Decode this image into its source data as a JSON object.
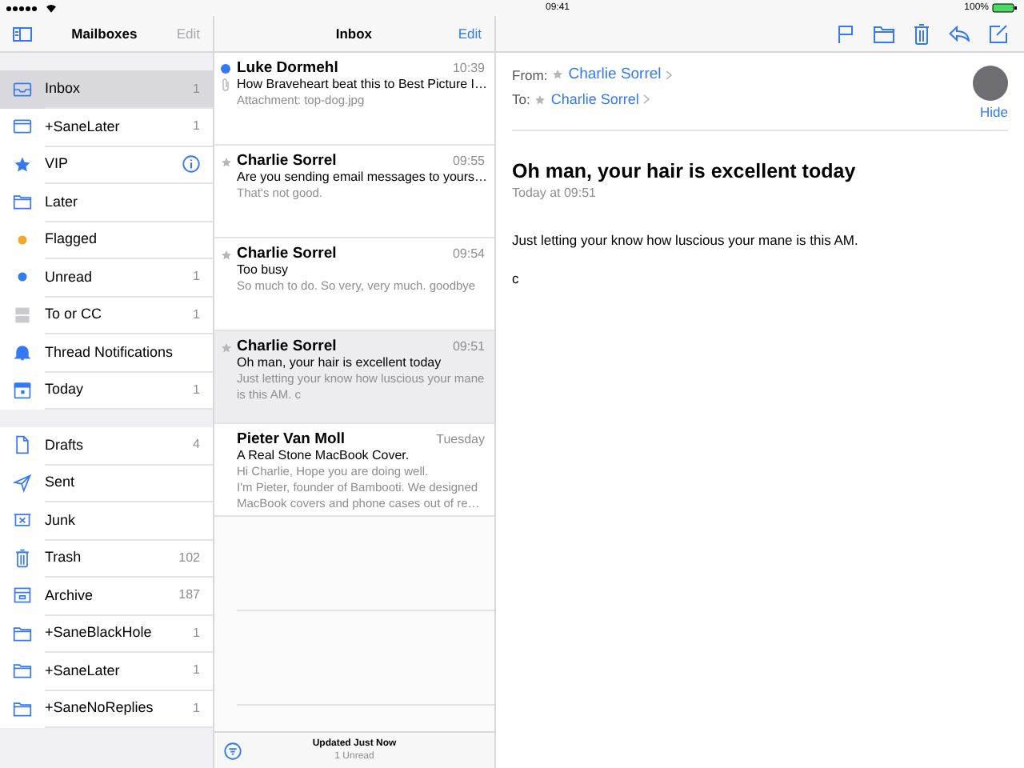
{
  "status_bar": {
    "time": "09:41",
    "battery": "100%"
  },
  "sidebar": {
    "title": "Mailboxes",
    "edit": {
      "label": "Edit",
      "disabled": true
    },
    "sections": [
      {
        "items": [
          {
            "kind": "inbox",
            "label": "Inbox",
            "count": "1",
            "selected": true
          },
          {
            "kind": "tray",
            "label": "+SaneLater",
            "count": "1",
            "selected": false
          },
          {
            "kind": "vip",
            "label": "VIP",
            "selected": false
          },
          {
            "kind": "folder",
            "label": "Later",
            "selected": false
          },
          {
            "kind": "dot",
            "label": "Flagged",
            "color": "#f5a623",
            "selected": false
          },
          {
            "kind": "dot",
            "label": "Unread",
            "count": "1",
            "color": "#2f7cf6",
            "selected": false
          },
          {
            "kind": "tocc",
            "label": "To or CC",
            "count": "1",
            "selected": false
          },
          {
            "kind": "bell",
            "label": "Thread Notifications",
            "selected": false
          },
          {
            "kind": "calendar",
            "label": "Today",
            "count": "1",
            "selected": false
          }
        ]
      },
      {
        "items": [
          {
            "kind": "drafts",
            "label": "Drafts",
            "count": "4",
            "selected": false
          },
          {
            "kind": "sent",
            "label": "Sent",
            "selected": false
          },
          {
            "kind": "junk",
            "label": "Junk",
            "selected": false
          },
          {
            "kind": "trash",
            "label": "Trash",
            "count": "102",
            "selected": false
          },
          {
            "kind": "archive",
            "label": "Archive",
            "count": "187",
            "selected": false
          },
          {
            "kind": "folder",
            "label": "+SaneBlackHole",
            "count": "1",
            "selected": false
          },
          {
            "kind": "folder",
            "label": "+SaneLater",
            "count": "1",
            "selected": false
          },
          {
            "kind": "folder",
            "label": "+SaneNoReplies",
            "count": "1",
            "selected": false
          }
        ]
      }
    ]
  },
  "inbox": {
    "title": "Inbox",
    "edit": {
      "label": "Edit",
      "disabled": false
    },
    "messages": [
      {
        "sender": "Luke Dormehl",
        "time": "10:39",
        "subject": "How Braveheart beat this to Best Picture I…",
        "preview": "Attachment: top-dog.jpg",
        "unread": true,
        "vip": false,
        "attachment": true,
        "selected": false
      },
      {
        "sender": "Charlie Sorrel",
        "time": "09:55",
        "subject": "Are you sending email messages to yours…",
        "preview": "That's not good.",
        "unread": false,
        "vip": true,
        "attachment": false,
        "selected": false
      },
      {
        "sender": "Charlie Sorrel",
        "time": "09:54",
        "subject": "Too busy",
        "preview": "So much to do. So very, very much. goodbye",
        "unread": false,
        "vip": true,
        "attachment": false,
        "selected": false
      },
      {
        "sender": "Charlie Sorrel",
        "time": "09:51",
        "subject": "Oh man, your hair is excellent today",
        "preview": "Just letting your know how luscious your mane is this AM. c",
        "unread": false,
        "vip": true,
        "attachment": false,
        "selected": true
      },
      {
        "sender": "Pieter Van Moll",
        "time": "Tuesday",
        "subject": "A Real Stone MacBook Cover.",
        "preview": "Hi Charlie, Hope you are doing well.\nI'm Pieter, founder of Bambooti. We designed MacBook covers and phone cases out of re…",
        "unread": false,
        "vip": false,
        "attachment": false,
        "selected": false
      }
    ],
    "footer": {
      "updated": "Updated Just Now",
      "unread": "1 Unread"
    }
  },
  "message": {
    "from_label": "From:",
    "from_name": "Charlie Sorrel",
    "to_label": "To:",
    "to_name": "Charlie Sorrel",
    "hide": "Hide",
    "subject": "Oh man, your hair is excellent today",
    "date": "Today at 09:51",
    "body": [
      "Just letting your know how luscious your mane is this AM.",
      "c"
    ]
  }
}
